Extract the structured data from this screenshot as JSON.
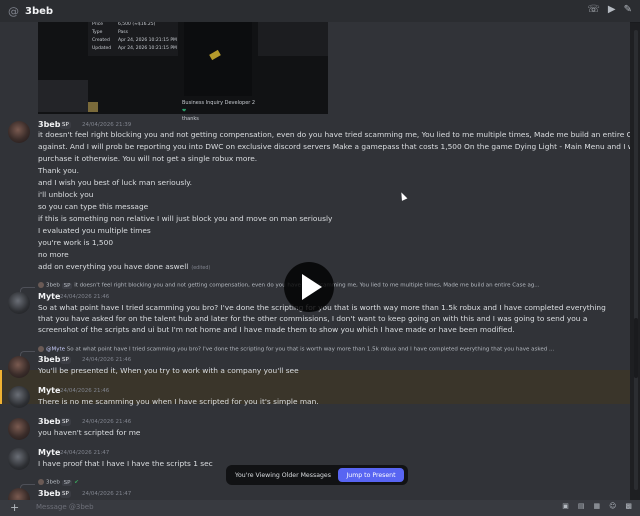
{
  "header": {
    "at_symbol": "@",
    "title": "3beb"
  },
  "embed": {
    "left_panel": [
      [
        "Price",
        "6,500 (≈$16.25)"
      ],
      [
        "Type",
        "Pass"
      ],
      [
        "Created",
        "Apr 24, 2026 10:21:15 PM"
      ],
      [
        "Updated",
        "Apr 24, 2026 10:21:15 PM"
      ]
    ],
    "right_lines": [
      "Business Inquiry Developer 2",
      "thanks"
    ]
  },
  "messages": {
    "m1": {
      "username": "3beb",
      "badge": "SP",
      "timestamp": "24/04/2026 21:39",
      "lines": [
        "it doesn't feel right blocking you and not getting compensation, even do you have tried scamming me, You lied to me multiple times, Made me build an entire Case",
        "against. And I will prob be reporting you into DWC on exclusive discord servers Make a gamepass that costs 1,500 On the game Dying Light - Main Menu and I will",
        "purchase it otherwise. You will not get a single robux more.",
        "Thank you.",
        "and I wish you best of luck man seriously.",
        "i'll unblock you",
        "so you can type this message",
        "if this is something non relative I will just block you and move on man seriously",
        "I evaluated you multiple times",
        "you're work is 1,500",
        "no more",
        "add on everything you have done aswell"
      ],
      "edited": "(edited)"
    },
    "m2": {
      "reply_user": "3beb",
      "reply_badge": "SP",
      "reply_text": "it doesn't feel right blocking you and not getting compensation, even do you have tried scamming me, You lied to me multiple times, Made me build an entire Case ag...",
      "username": "Myte",
      "timestamp": "24/04/2026 21:46",
      "text": "So at what point have I tried scamming you bro? I've done the scripting for you that is worth way more than 1.5k robux and I have completed everything that you have asked for on the talent hub and later for the other commissions, I don't want to keep going on with this and I was going to send you a screenshot of the scripts and ui but I'm not home and I have made them to show you which I have made or have been modified."
    },
    "m3": {
      "reply_user": "@Myte",
      "reply_text": "So at what point have I tried scamming you bro? I've done the scripting for you that is worth way more than 1.5k robux and I have completed everything that you have asked ...",
      "username": "3beb",
      "badge": "SP",
      "timestamp": "24/04/2026 21:46",
      "text": "You'll be presented it, When you try to work with a company you'll see"
    },
    "m4": {
      "username": "Myte",
      "timestamp": "24/04/2026 21:46",
      "text": "There is no me scamming you when I have scripted for you it's simple man."
    },
    "m5": {
      "username": "3beb",
      "badge": "SP",
      "timestamp": "24/04/2026 21:46",
      "text": "you haven't scripted for me"
    },
    "m6": {
      "username": "Myte",
      "timestamp": "24/04/2026 21:47",
      "text": "I have proof that I have I have the scripts 1 sec"
    },
    "m7": {
      "reply_user": "3beb",
      "reply_badge": "SP",
      "username": "3beb",
      "badge": "SP",
      "timestamp": "24/04/2026 21:47"
    }
  },
  "older_bar": {
    "label": "You're Viewing Older Messages",
    "button": "Jump to Present"
  },
  "composer": {
    "placeholder": "Message @3beb"
  },
  "colors": {
    "accent": "#5865f2",
    "mention_highlight": "#f0b232",
    "background": "#313338"
  }
}
